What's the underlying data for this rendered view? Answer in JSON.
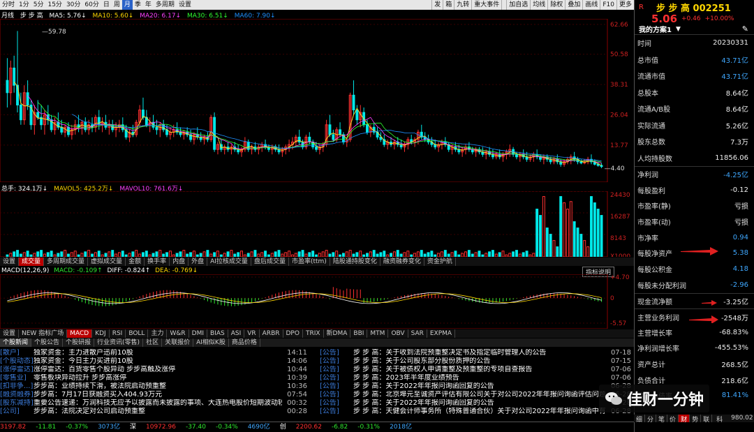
{
  "toolbar": {
    "periods": [
      "分时",
      "1分",
      "5分",
      "15分",
      "30分",
      "60分",
      "日",
      "周",
      "月",
      "季",
      "年",
      "多周期",
      "设置"
    ],
    "selected": "月",
    "actions": [
      "发",
      "箱",
      "九转",
      "重大事件",
      "",
      "加自选",
      "均线",
      "除权",
      "叠加",
      "画线",
      "F10",
      "更多"
    ]
  },
  "main_legend": {
    "period": "月线",
    "stock": "步 步 高",
    "ma5": "MA5: 5.76↓",
    "ma10": "MA10: 5.60↓",
    "ma20": "MA20: 6.17↓",
    "ma30": "MA30: 6.51↓",
    "ma60": "MA60: 7.90↓"
  },
  "price_axis": [
    "62.66",
    "50.58",
    "38.31",
    "26.04",
    "13.77"
  ],
  "price_marks": {
    "high": "59.78",
    "low": "4.40"
  },
  "volume_legend": {
    "total": "总手: 324.1万↓",
    "mavol5": "MAVOL5: 425.2万↓",
    "mavol10": "MAVOL10: 761.6万↓"
  },
  "volume_axis": [
    "24430",
    "16287",
    "8143",
    "X1000"
  ],
  "indicator_tabs": [
    "设置",
    "成交量",
    "多周期成交量",
    "虚拟成交量",
    "金额",
    "换手率",
    "内盘",
    "外盘",
    "AI拉核成交量",
    "盘后成交量",
    "市盈率(ttm)",
    "陆股通持股变化",
    "融资融券变化",
    "资金护航"
  ],
  "macd_legend": {
    "name": "MACD(12,26,9)",
    "macd": "MACD: -0.109↑",
    "diff": "DIFF: -0.824↑",
    "dea": "DEA: -0.769↓"
  },
  "macd_axis": [
    "+4.70",
    "0",
    "-5.57"
  ],
  "indicator_btn": "指标说明",
  "sub_tabs": [
    "设置",
    "NEW 指标广场",
    "MACD",
    "KDJ",
    "RSI",
    "BOLL",
    "主力",
    "W&R",
    "DMI",
    "BIAS",
    "ASI",
    "VR",
    "ARBR",
    "DPO",
    "TRIX",
    "新DMA",
    "BBI",
    "MTM",
    "OBV",
    "SAR",
    "EXPMA"
  ],
  "sub_tab_selected": "MACD",
  "news_tabs": [
    "个股新闻",
    "个股公告",
    "个股研报",
    "行业资讯(零售)",
    "社区",
    "关联报价",
    "AI相似K股",
    "商品价格"
  ],
  "news_left": [
    {
      "tag": "散户",
      "text": "独家资金：主力进散户迅前10股",
      "time": "14:11"
    },
    {
      "tag": "个股动态",
      "text": "独家资金：今日主力买进前10股",
      "time": "14:06"
    },
    {
      "tag": "涨停雷达",
      "text": "涨停雷达：百货零售个股异动 步步高触及涨停",
      "time": "10:44"
    },
    {
      "tag": "零售业",
      "text": "零售板块异动拉升 步步高涨停",
      "time": "10:39"
    },
    {
      "tag": "扣非争...",
      "text": "步步高：业绩持续下滑，被法院启动预重整",
      "time": "10:36"
    },
    {
      "tag": "融资融券",
      "text": "步步高：7月17日获融资买入404.93万元",
      "time": "07:54"
    },
    {
      "tag": "股东减持",
      "text": "重要公告速递：万润科技无应予以披露而未披露的事项、大连热电股价短期波动较大",
      "time": "00:32"
    },
    {
      "tag": "公司",
      "text": "步步高：法院决定对公司启动预重整",
      "time": "00:28"
    }
  ],
  "news_right": [
    {
      "tag": "公告",
      "text": "步 步 高：关于收到法院预重整决定书及指定临时管理人的公告",
      "time": "07-18"
    },
    {
      "tag": "公告",
      "text": "步 步 高：关于公司股东部分股份质押的公告",
      "time": "07-15"
    },
    {
      "tag": "公告",
      "text": "步 步 高：关于被债权人申请重整及预重整的专项自查报告",
      "time": "07-06"
    },
    {
      "tag": "公告",
      "text": "步 步 高：2023年半年度业绩预告",
      "time": "07-06"
    },
    {
      "tag": "公告",
      "text": "步 步 高：关于2022年年报问询函回复的公告",
      "time": "06-28"
    },
    {
      "tag": "公告",
      "text": "步 步 高：北京埠元至诚资产评估有限公司关于对公司2022年年报问询函评估问题...",
      "time": "06-28"
    },
    {
      "tag": "公告",
      "text": "步 步 高：关于2022年年报问询函回复的公告",
      "time": "06-28"
    },
    {
      "tag": "公告",
      "text": "步 步 高：天健会计师事务所（特殊普通合伙）关于对公司2022年年报问询函中有...",
      "time": "06-28"
    }
  ],
  "status": [
    {
      "v": "3197.82",
      "c": "red"
    },
    {
      "v": "-11.81",
      "c": "grn"
    },
    {
      "v": "-0.37%",
      "c": "grn"
    },
    {
      "v": "3073亿",
      "c": "blue"
    },
    {
      "v": "深",
      "c": "wht"
    },
    {
      "v": "10972.96",
      "c": "red"
    },
    {
      "v": "-37.40",
      "c": "grn"
    },
    {
      "v": "-0.34%",
      "c": "grn"
    },
    {
      "v": "4690亿",
      "c": "blue"
    },
    {
      "v": "创",
      "c": "wht"
    },
    {
      "v": "2200.62",
      "c": "red"
    },
    {
      "v": "-6.82",
      "c": "grn"
    },
    {
      "v": "-0.31%",
      "c": "grn"
    },
    {
      "v": "2018亿",
      "c": "blue"
    }
  ],
  "right_panel": {
    "r_label": "R",
    "stock_title": "步 步 高 002251",
    "price": "5.06",
    "change": "+0.46",
    "pct": "+10.00%",
    "plan": "我的方案1",
    "rows": [
      {
        "label": "时间",
        "value": "20230331",
        "c": "wht"
      },
      {
        "label": "总市值",
        "value": "43.71亿",
        "c": "blue"
      },
      {
        "label": "流通市值",
        "value": "43.71亿",
        "c": "blue"
      },
      {
        "label": "总股本",
        "value": "8.64亿",
        "c": "wht"
      },
      {
        "label": "流通A/B股",
        "value": "8.64亿",
        "c": "wht"
      },
      {
        "label": "实际流通",
        "value": "5.26亿",
        "c": "wht"
      },
      {
        "label": "股东总数",
        "value": "7.3万",
        "c": "yel"
      },
      {
        "label": "人均持股数",
        "value": "11856.06",
        "c": "yel"
      },
      {
        "label": "净利润",
        "value": "-4.25亿",
        "c": "blue"
      },
      {
        "label": "每股盈利",
        "value": "-0.12",
        "c": "wht"
      },
      {
        "label": "市盈率(静)",
        "value": "亏损",
        "c": "wht"
      },
      {
        "label": "市盈率(动)",
        "value": "亏损",
        "c": "wht"
      },
      {
        "label": "市净率",
        "value": "0.94",
        "c": "blue"
      },
      {
        "label": "每股净资产",
        "value": "5.38",
        "c": "blue"
      },
      {
        "label": "每股公积金",
        "value": "4.18",
        "c": "blue"
      },
      {
        "label": "每股未分配利润",
        "value": "-2.96",
        "c": "blue"
      },
      {
        "label": "现金流净额",
        "value": "-3.25亿",
        "c": "wht"
      },
      {
        "label": "主营业务利润",
        "value": "-2548万",
        "c": "wht"
      },
      {
        "label": "主营增长率",
        "value": "-68.83%",
        "c": "wht"
      },
      {
        "label": "净利润增长率",
        "value": "-455.53%",
        "c": "wht"
      },
      {
        "label": "资产总计",
        "value": "268.5亿",
        "c": "wht"
      },
      {
        "label": "负债合计",
        "value": "218.6亿",
        "c": "wht"
      },
      {
        "label": "资产负债率",
        "value": "81.41%",
        "c": "blue"
      }
    ],
    "tabs": [
      "细",
      "分",
      "笔",
      "价",
      "财",
      "势",
      "联"
    ],
    "tab_selected": "财",
    "bottom_quote": [
      {
        "v": "科",
        "c": "wht"
      },
      {
        "v": "980.02",
        "c": "red"
      },
      {
        "v": "-4.80",
        "c": "grn"
      }
    ]
  },
  "watermark": "佳财一分钟",
  "colors": {
    "up": "#ff3030",
    "down": "#00e8e8",
    "ma5": "#ffffff",
    "ma10": "#ffd700",
    "ma20": "#ff40ff",
    "ma30": "#30ff30",
    "ma60": "#1e90ff"
  },
  "chart_data": {
    "type": "candlestick",
    "period": "monthly",
    "ylim": [
      4.4,
      62.66
    ],
    "ohlc": [
      [
        40,
        49,
        29,
        35
      ],
      [
        35,
        48,
        30,
        45
      ],
      [
        45,
        50,
        35,
        38
      ],
      [
        38,
        60,
        27,
        30
      ],
      [
        30,
        35,
        22,
        24
      ],
      [
        24,
        38,
        22,
        35
      ],
      [
        35,
        40,
        28,
        30
      ],
      [
        30,
        32,
        20,
        22
      ],
      [
        22,
        30,
        18,
        27
      ],
      [
        27,
        32,
        24,
        25
      ],
      [
        25,
        30,
        20,
        22
      ],
      [
        22,
        28,
        18,
        26
      ],
      [
        26,
        30,
        22,
        24
      ],
      [
        24,
        26,
        19,
        20
      ],
      [
        20,
        25,
        18,
        23
      ],
      [
        23,
        27,
        20,
        21
      ],
      [
        21,
        24,
        18,
        19
      ],
      [
        19,
        22,
        17,
        21
      ],
      [
        21,
        23,
        17,
        18
      ],
      [
        18,
        22,
        16,
        20
      ],
      [
        20,
        24,
        18,
        22
      ],
      [
        22,
        26,
        19,
        21
      ],
      [
        21,
        24,
        18,
        23
      ],
      [
        23,
        25,
        19,
        20
      ],
      [
        20,
        24,
        18,
        22
      ],
      [
        22,
        25,
        19,
        21
      ],
      [
        21,
        26,
        19,
        25
      ],
      [
        25,
        28,
        20,
        22
      ],
      [
        22,
        25,
        19,
        23
      ],
      [
        23,
        26,
        20,
        21
      ],
      [
        21,
        24,
        18,
        22
      ],
      [
        22,
        24,
        19,
        20
      ],
      [
        20,
        23,
        17,
        21
      ],
      [
        21,
        24,
        19,
        22
      ],
      [
        22,
        25,
        19,
        20
      ],
      [
        20,
        22,
        16,
        17
      ],
      [
        17,
        20,
        15,
        19
      ],
      [
        19,
        22,
        17,
        18
      ],
      [
        18,
        24,
        17,
        23
      ],
      [
        23,
        30,
        21,
        28
      ],
      [
        28,
        33,
        24,
        25
      ],
      [
        25,
        28,
        21,
        22
      ],
      [
        22,
        25,
        19,
        23
      ],
      [
        23,
        26,
        20,
        21
      ],
      [
        21,
        24,
        18,
        20
      ],
      [
        20,
        23,
        17,
        22
      ],
      [
        22,
        24,
        19,
        20
      ],
      [
        20,
        22,
        17,
        18
      ],
      [
        18,
        21,
        16,
        19
      ],
      [
        19,
        22,
        17,
        20
      ],
      [
        20,
        23,
        18,
        19
      ],
      [
        19,
        21,
        17,
        18
      ],
      [
        18,
        20,
        16,
        19
      ],
      [
        19,
        21,
        17,
        18
      ],
      [
        18,
        20,
        15,
        16
      ],
      [
        16,
        19,
        14,
        18
      ],
      [
        18,
        21,
        16,
        17
      ],
      [
        17,
        19,
        15,
        16
      ],
      [
        16,
        18,
        14,
        17
      ],
      [
        17,
        19,
        15,
        16
      ],
      [
        16,
        26,
        15,
        25
      ],
      [
        25,
        27,
        11,
        12
      ],
      [
        12,
        15,
        10,
        14
      ],
      [
        14,
        16,
        11,
        12
      ],
      [
        12,
        14,
        10,
        13
      ],
      [
        13,
        15,
        11,
        12
      ],
      [
        12,
        14,
        10,
        13
      ],
      [
        13,
        15,
        11,
        12
      ],
      [
        12,
        14,
        10,
        11
      ],
      [
        11,
        13,
        9,
        12
      ],
      [
        12,
        17,
        11,
        15
      ],
      [
        15,
        16,
        11,
        12
      ],
      [
        12,
        14,
        10,
        13
      ],
      [
        13,
        15,
        11,
        12
      ],
      [
        12,
        14,
        10,
        13
      ],
      [
        13,
        15,
        11,
        14
      ],
      [
        14,
        16,
        12,
        13
      ],
      [
        13,
        14,
        11,
        12
      ],
      [
        12,
        14,
        10,
        13
      ],
      [
        13,
        14,
        11,
        12
      ],
      [
        12,
        14,
        10,
        11
      ],
      [
        11,
        13,
        9,
        12
      ],
      [
        12,
        14,
        10,
        13
      ],
      [
        13,
        16,
        11,
        14
      ],
      [
        14,
        17,
        12,
        15
      ],
      [
        15,
        18,
        13,
        17
      ],
      [
        17,
        20,
        14,
        15
      ],
      [
        15,
        16,
        12,
        13
      ],
      [
        13,
        18,
        12,
        17
      ],
      [
        17,
        19,
        14,
        15
      ],
      [
        15,
        16,
        12,
        13
      ],
      [
        13,
        15,
        11,
        12
      ],
      [
        12,
        14,
        10,
        13
      ],
      [
        13,
        15,
        11,
        14
      ],
      [
        14,
        24,
        13,
        22
      ],
      [
        22,
        26,
        17,
        18
      ],
      [
        18,
        20,
        15,
        16
      ],
      [
        16,
        21,
        15,
        20
      ],
      [
        20,
        23,
        17,
        18
      ],
      [
        18,
        19,
        14,
        15
      ],
      [
        15,
        17,
        13,
        16
      ],
      [
        16,
        35,
        15,
        34
      ],
      [
        34,
        40,
        26,
        28
      ],
      [
        28,
        30,
        22,
        24
      ],
      [
        24,
        30,
        21,
        27
      ],
      [
        27,
        29,
        21,
        22
      ],
      [
        22,
        24,
        18,
        19
      ],
      [
        19,
        22,
        17,
        21
      ],
      [
        21,
        23,
        18,
        19
      ],
      [
        19,
        21,
        16,
        17
      ],
      [
        17,
        19,
        15,
        16
      ],
      [
        16,
        18,
        13,
        14
      ],
      [
        14,
        16,
        12,
        15
      ],
      [
        15,
        17,
        13,
        14
      ],
      [
        14,
        16,
        12,
        15
      ],
      [
        15,
        17,
        13,
        14
      ],
      [
        14,
        16,
        12,
        13
      ],
      [
        13,
        15,
        11,
        14
      ],
      [
        14,
        17,
        12,
        16
      ],
      [
        16,
        18,
        14,
        15
      ],
      [
        15,
        17,
        13,
        16
      ],
      [
        16,
        20,
        14,
        19
      ],
      [
        19,
        22,
        16,
        17
      ],
      [
        17,
        19,
        15,
        16
      ],
      [
        16,
        18,
        14,
        15
      ],
      [
        15,
        17,
        13,
        14
      ],
      [
        14,
        16,
        12,
        13
      ],
      [
        13,
        15,
        11,
        14
      ],
      [
        14,
        16,
        12,
        15
      ],
      [
        15,
        17,
        13,
        14
      ],
      [
        14,
        15,
        11,
        12
      ],
      [
        12,
        14,
        10,
        13
      ],
      [
        13,
        15,
        11,
        12
      ],
      [
        12,
        14,
        10,
        11
      ],
      [
        11,
        13,
        9,
        12
      ],
      [
        12,
        14,
        10,
        13
      ],
      [
        13,
        15,
        11,
        12
      ],
      [
        12,
        13,
        10,
        11
      ],
      [
        11,
        13,
        9,
        12
      ],
      [
        12,
        13,
        10,
        11
      ],
      [
        11,
        13,
        9,
        10
      ],
      [
        10,
        12,
        8,
        11
      ],
      [
        11,
        13,
        9,
        10
      ],
      [
        10,
        12,
        8,
        9
      ],
      [
        9,
        11,
        8,
        10
      ],
      [
        10,
        12,
        8,
        9
      ],
      [
        9,
        11,
        7,
        10
      ],
      [
        10,
        12,
        8,
        11
      ],
      [
        11,
        14,
        9,
        12
      ],
      [
        12,
        13,
        9,
        10
      ],
      [
        10,
        11,
        8,
        9
      ],
      [
        9,
        11,
        7,
        10
      ],
      [
        10,
        12,
        8,
        9
      ],
      [
        9,
        11,
        7,
        8
      ],
      [
        8,
        10,
        7,
        9
      ],
      [
        9,
        11,
        7,
        10
      ],
      [
        10,
        12,
        8,
        9
      ],
      [
        9,
        10,
        7,
        8
      ],
      [
        8,
        10,
        6,
        9
      ],
      [
        9,
        10,
        7,
        8
      ],
      [
        8,
        9,
        6,
        7
      ],
      [
        7,
        9,
        6,
        8
      ],
      [
        8,
        10,
        6,
        7
      ],
      [
        7,
        8,
        5,
        6
      ],
      [
        6,
        8,
        5,
        7
      ],
      [
        7,
        9,
        6,
        8
      ],
      [
        8,
        10,
        6,
        9
      ],
      [
        9,
        11,
        7,
        8
      ],
      [
        8,
        9,
        6,
        7
      ],
      [
        7,
        8,
        6,
        6.5
      ],
      [
        6.5,
        8,
        6,
        7
      ],
      [
        7,
        9,
        6,
        8
      ],
      [
        8,
        10,
        6,
        7
      ],
      [
        7,
        8,
        5.5,
        6
      ],
      [
        6,
        7,
        5,
        5.5
      ],
      [
        5.5,
        6.5,
        4.4,
        5.06
      ]
    ],
    "volume_max": 24430,
    "macd_range": [
      -5.57,
      4.7
    ]
  }
}
